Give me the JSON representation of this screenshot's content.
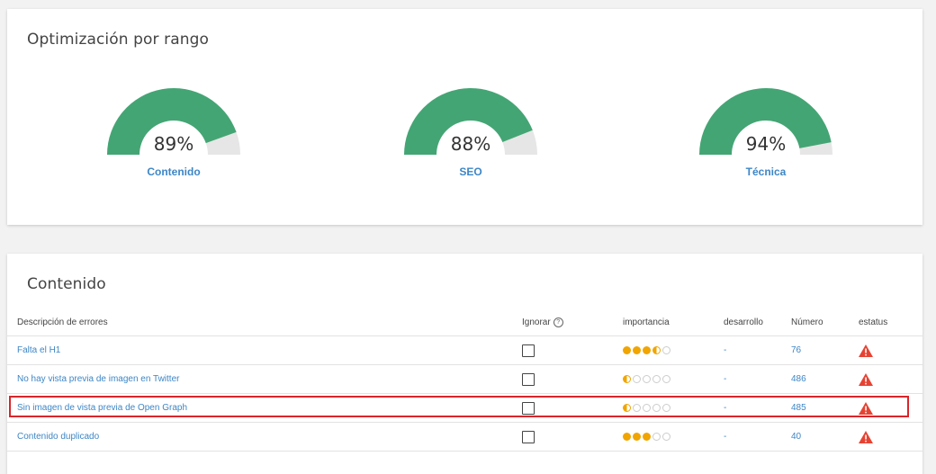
{
  "top_card": {
    "title": "Optimización por rango",
    "gauges": [
      {
        "value": "89%",
        "percent": 89,
        "label": "Contenido"
      },
      {
        "value": "88%",
        "percent": 88,
        "label": "SEO"
      },
      {
        "value": "94%",
        "percent": 94,
        "label": "Técnica"
      }
    ]
  },
  "colors": {
    "gauge_fill": "#44a574",
    "gauge_track": "#e6e6e6",
    "link": "#3d86c6",
    "dot": "#f0a500",
    "warning": "#e64333",
    "highlight": "#d9262b"
  },
  "content_card": {
    "title": "Contenido",
    "headers": {
      "description": "Descripción de errores",
      "ignore": "Ignorar",
      "importance": "importancia",
      "development": "desarrollo",
      "number": "Número",
      "status": "estatus"
    },
    "rows": [
      {
        "description": "Falta el H1",
        "importance": 3.5,
        "development": "-",
        "number": "76",
        "status_icon": "warning-icon"
      },
      {
        "description": "No hay vista previa de imagen en Twitter",
        "importance": 0.5,
        "development": "-",
        "number": "486",
        "status_icon": "warning-icon"
      },
      {
        "description": "Sin imagen de vista previa de Open Graph",
        "importance": 0.5,
        "development": "-",
        "number": "485",
        "status_icon": "warning-icon"
      },
      {
        "description": "Contenido duplicado",
        "importance": 3,
        "development": "-",
        "number": "40",
        "status_icon": "warning-icon"
      }
    ]
  }
}
